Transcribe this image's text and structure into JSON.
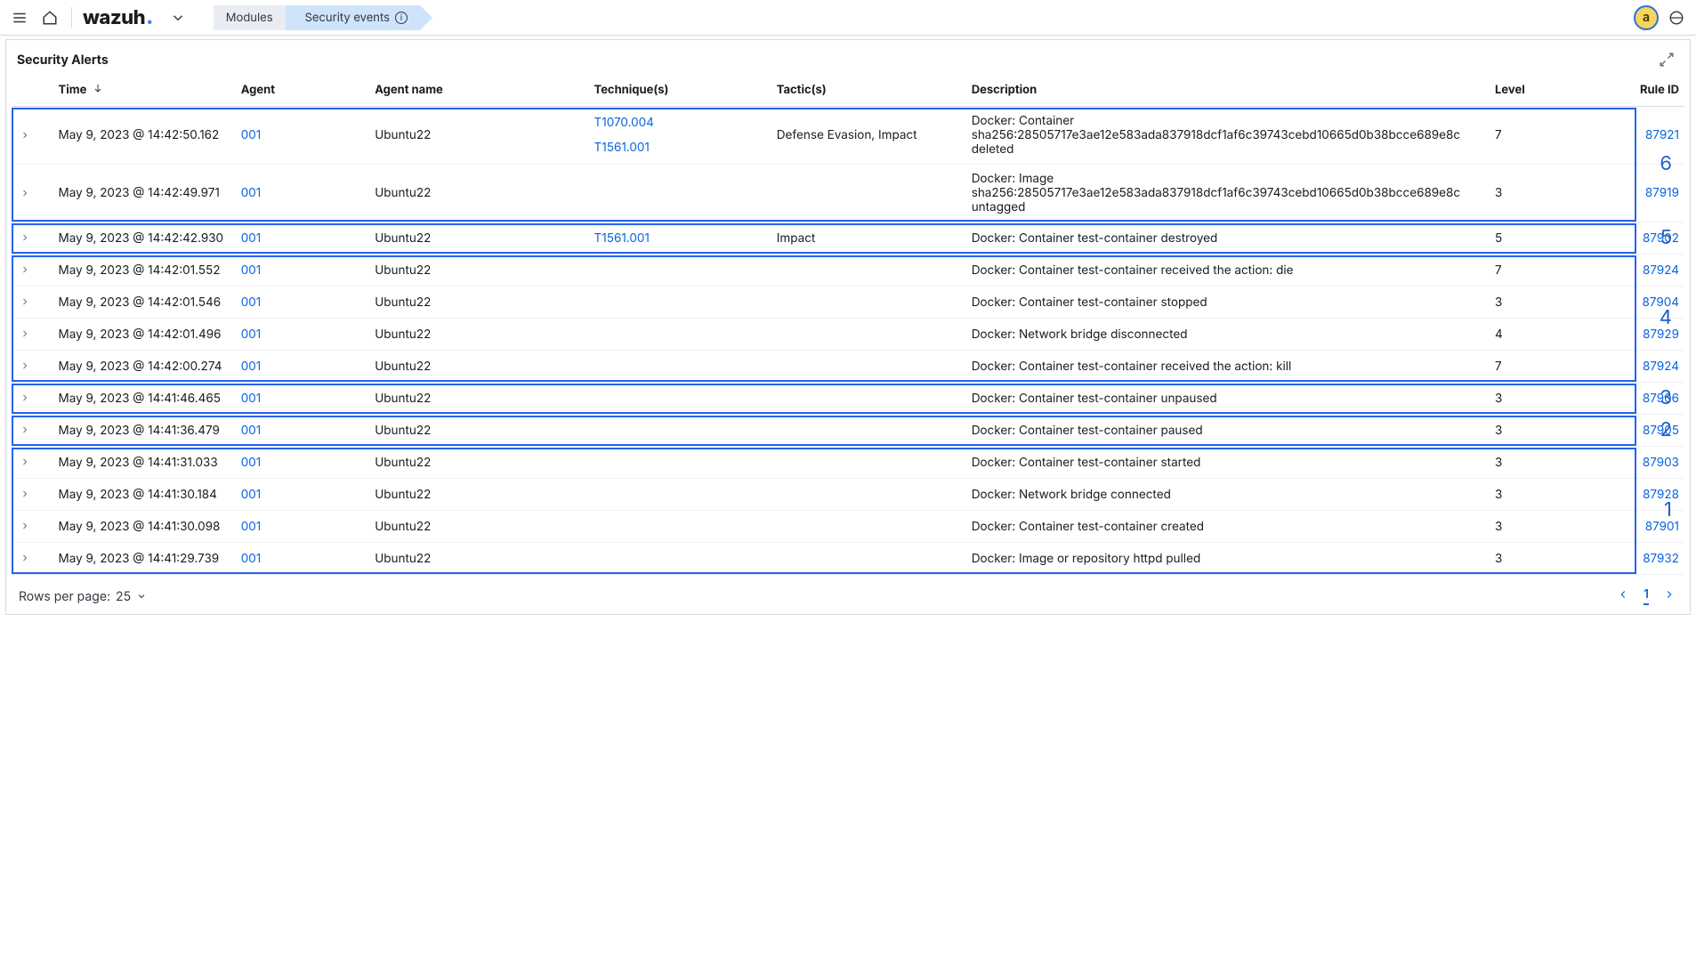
{
  "header": {
    "brand": "wazuh",
    "crumb1": "Modules",
    "crumb2": "Security events",
    "user_initial": "a"
  },
  "panel": {
    "title": "Security Alerts"
  },
  "columns": {
    "time": "Time",
    "agent": "Agent",
    "agent_name": "Agent name",
    "technique": "Technique(s)",
    "tactic": "Tactic(s)",
    "description": "Description",
    "level": "Level",
    "rule_id": "Rule ID"
  },
  "rows": [
    {
      "time": "May 9, 2023 @ 14:42:50.162",
      "agent": "001",
      "agent_name": "Ubuntu22",
      "techniques": [
        "T1070.004",
        "T1561.001"
      ],
      "tactic": "Defense Evasion, Impact",
      "description": "Docker: Container sha256:28505717e3ae12e583ada837918dcf1af6c39743cebd10665d0b38bcce689e8c deleted",
      "level": "7",
      "rule_id": "87921"
    },
    {
      "time": "May 9, 2023 @ 14:42:49.971",
      "agent": "001",
      "agent_name": "Ubuntu22",
      "techniques": [],
      "tactic": "",
      "description": "Docker: Image sha256:28505717e3ae12e583ada837918dcf1af6c39743cebd10665d0b38bcce689e8c untagged",
      "level": "3",
      "rule_id": "87919"
    },
    {
      "time": "May 9, 2023 @ 14:42:42.930",
      "agent": "001",
      "agent_name": "Ubuntu22",
      "techniques": [
        "T1561.001"
      ],
      "tactic": "Impact",
      "description": "Docker: Container test-container destroyed",
      "level": "5",
      "rule_id": "87902"
    },
    {
      "time": "May 9, 2023 @ 14:42:01.552",
      "agent": "001",
      "agent_name": "Ubuntu22",
      "techniques": [],
      "tactic": "",
      "description": "Docker: Container test-container received the action: die",
      "level": "7",
      "rule_id": "87924"
    },
    {
      "time": "May 9, 2023 @ 14:42:01.546",
      "agent": "001",
      "agent_name": "Ubuntu22",
      "techniques": [],
      "tactic": "",
      "description": "Docker: Container test-container stopped",
      "level": "3",
      "rule_id": "87904"
    },
    {
      "time": "May 9, 2023 @ 14:42:01.496",
      "agent": "001",
      "agent_name": "Ubuntu22",
      "techniques": [],
      "tactic": "",
      "description": "Docker: Network bridge disconnected",
      "level": "4",
      "rule_id": "87929"
    },
    {
      "time": "May 9, 2023 @ 14:42:00.274",
      "agent": "001",
      "agent_name": "Ubuntu22",
      "techniques": [],
      "tactic": "",
      "description": "Docker: Container test-container received the action: kill",
      "level": "7",
      "rule_id": "87924"
    },
    {
      "time": "May 9, 2023 @ 14:41:46.465",
      "agent": "001",
      "agent_name": "Ubuntu22",
      "techniques": [],
      "tactic": "",
      "description": "Docker: Container test-container unpaused",
      "level": "3",
      "rule_id": "87906"
    },
    {
      "time": "May 9, 2023 @ 14:41:36.479",
      "agent": "001",
      "agent_name": "Ubuntu22",
      "techniques": [],
      "tactic": "",
      "description": "Docker: Container test-container paused",
      "level": "3",
      "rule_id": "87905"
    },
    {
      "time": "May 9, 2023 @ 14:41:31.033",
      "agent": "001",
      "agent_name": "Ubuntu22",
      "techniques": [],
      "tactic": "",
      "description": "Docker: Container test-container started",
      "level": "3",
      "rule_id": "87903"
    },
    {
      "time": "May 9, 2023 @ 14:41:30.184",
      "agent": "001",
      "agent_name": "Ubuntu22",
      "techniques": [],
      "tactic": "",
      "description": "Docker: Network bridge connected",
      "level": "3",
      "rule_id": "87928"
    },
    {
      "time": "May 9, 2023 @ 14:41:30.098",
      "agent": "001",
      "agent_name": "Ubuntu22",
      "techniques": [],
      "tactic": "",
      "description": "Docker: Container test-container created",
      "level": "3",
      "rule_id": "87901"
    },
    {
      "time": "May 9, 2023 @ 14:41:29.739",
      "agent": "001",
      "agent_name": "Ubuntu22",
      "techniques": [],
      "tactic": "",
      "description": "Docker: Image or repository httpd pulled",
      "level": "3",
      "rule_id": "87932"
    }
  ],
  "annotations": [
    {
      "label": "6",
      "rows": [
        0,
        1
      ]
    },
    {
      "label": "5",
      "rows": [
        2,
        2
      ]
    },
    {
      "label": "4",
      "rows": [
        3,
        6
      ]
    },
    {
      "label": "3",
      "rows": [
        7,
        7
      ]
    },
    {
      "label": "2",
      "rows": [
        8,
        8
      ]
    },
    {
      "label": "1",
      "rows": [
        9,
        12
      ]
    }
  ],
  "footer": {
    "rows_per_page_label": "Rows per page:",
    "rows_per_page_value": "25",
    "current_page": "1"
  }
}
